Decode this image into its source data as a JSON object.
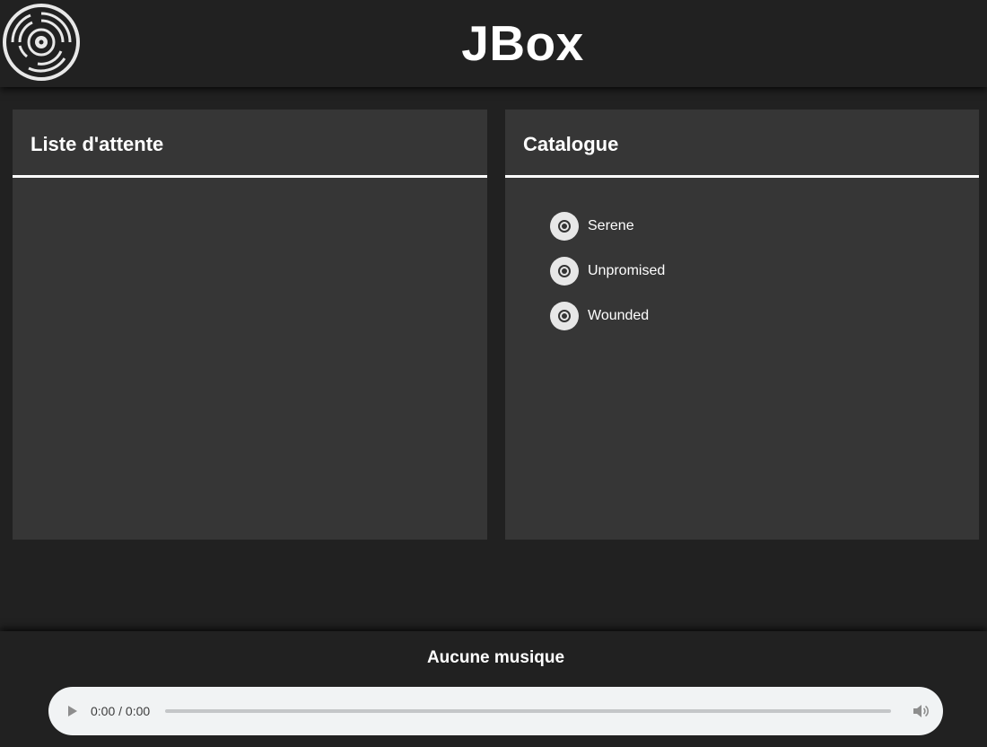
{
  "header": {
    "title": "JBox",
    "logo_icon": "vinyl-record-icon"
  },
  "queue": {
    "title": "Liste d'attente",
    "items": []
  },
  "catalog": {
    "title": "Catalogue",
    "items": [
      {
        "name": "Serene",
        "icon": "disc-icon"
      },
      {
        "name": "Unpromised",
        "icon": "disc-icon"
      },
      {
        "name": "Wounded",
        "icon": "disc-icon"
      }
    ]
  },
  "player": {
    "now_playing": "Aucune musique",
    "time": "0:00 / 0:00",
    "progress": 0,
    "play_icon": "play-icon",
    "volume_icon": "volume-icon"
  },
  "colors": {
    "background": "#212121",
    "panel": "#363636",
    "text": "#ffffff",
    "audio_bar": "#f1f3f4"
  }
}
